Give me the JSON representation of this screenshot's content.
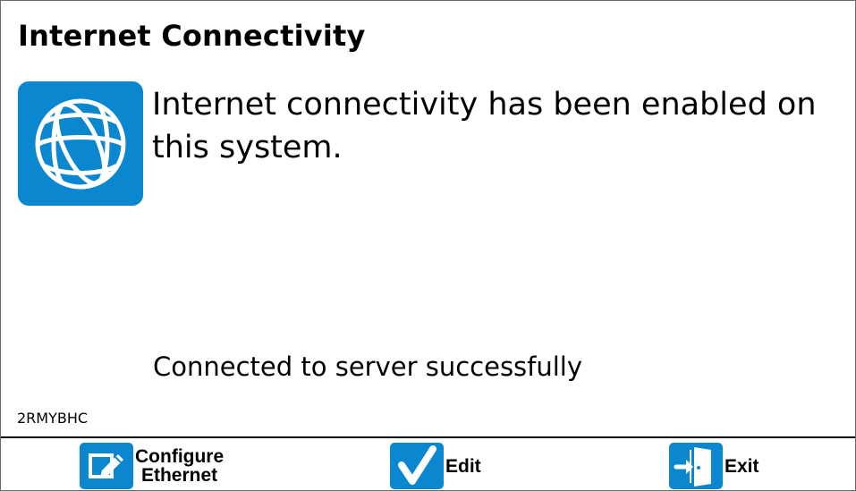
{
  "screen": {
    "title": "Internet Connectivity",
    "message": "Internet connectivity has been enabled on this system.",
    "status": "Connected to server successfully",
    "serial": "2RMYBHC"
  },
  "softkeys": [
    {
      "label": "Configure\nEthernet",
      "icon": "edit-pencil-icon"
    },
    {
      "label": "Edit",
      "icon": "check-icon"
    },
    {
      "label": "Exit",
      "icon": "exit-door-icon"
    }
  ],
  "colors": {
    "accent": "#0b87cf",
    "text": "#000000",
    "background": "#ffffff",
    "border": "#6a6a6a"
  },
  "icons": {
    "main": "globe-icon"
  }
}
